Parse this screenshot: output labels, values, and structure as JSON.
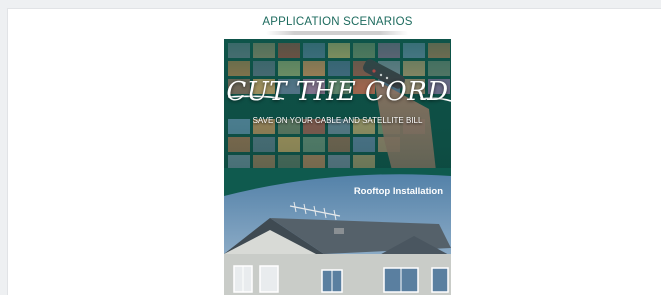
{
  "heading": {
    "text": "APPLICATION SCENARIOS"
  },
  "cord_panel": {
    "title": "CUT THE CORD",
    "subtitle": "SAVE ON YOUR CABLE AND SATELLITE BILL",
    "accent": "#0f5a4e"
  },
  "house_panel": {
    "label": "Rooftop Installation",
    "sky": "#6f94b4"
  },
  "icons": [
    "remote-control-icon",
    "tv-antenna-icon"
  ]
}
